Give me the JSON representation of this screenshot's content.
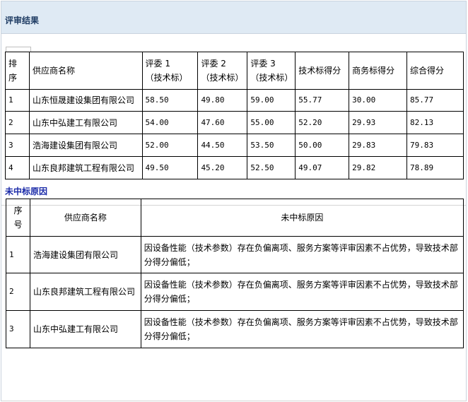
{
  "header": {
    "title": "评审结果"
  },
  "results": {
    "columns": {
      "rank": [
        "排",
        "序"
      ],
      "supplier": "供应商名称",
      "judge1": [
        "评委 1",
        "（技术标）"
      ],
      "judge2": [
        "评委 2",
        "（技术标）"
      ],
      "judge3": [
        "评委 3",
        "（技术标）"
      ],
      "tech_score": "技术标得分",
      "biz_score": "商务标得分",
      "total_score": "综合得分"
    },
    "rows": [
      {
        "rank": "1",
        "supplier": "山东恒晟建设集团有限公司",
        "j1": "58.50",
        "j2": "49.80",
        "j3": "59.00",
        "tech": "55.77",
        "biz": "30.00",
        "total": "85.77"
      },
      {
        "rank": "2",
        "supplier": "山东中弘建工有限公司",
        "j1": "54.00",
        "j2": "47.60",
        "j3": "55.00",
        "tech": "52.20",
        "biz": "29.93",
        "total": "82.13"
      },
      {
        "rank": "3",
        "supplier": "浩海建设集团有限公司",
        "j1": "52.00",
        "j2": "44.50",
        "j3": "53.50",
        "tech": "50.00",
        "biz": "29.83",
        "total": "79.83"
      },
      {
        "rank": "4",
        "supplier": "山东良邦建筑工程有限公司",
        "j1": "49.50",
        "j2": "45.20",
        "j3": "52.50",
        "tech": "49.07",
        "biz": "29.82",
        "total": "78.89"
      }
    ]
  },
  "reasons": {
    "title": "未中标原因",
    "columns": {
      "seq": [
        "序",
        "号"
      ],
      "supplier": "供应商名称",
      "reason": "未中标原因"
    },
    "rows": [
      {
        "seq": "1",
        "supplier": "浩海建设集团有限公司",
        "reason": "因设备性能（技术参数）存在负偏离项、服务方案等评审因素不占优势，导致技术部分得分偏低；"
      },
      {
        "seq": "2",
        "supplier": "山东良邦建筑工程有限公司",
        "reason": "因设备性能（技术参数）存在负偏离项、服务方案等评审因素不占优势，导致技术部分得分偏低；"
      },
      {
        "seq": "3",
        "supplier": "山东中弘建工有限公司",
        "reason": "因设备性能（技术参数）存在负偏离项、服务方案等评审因素不占优势，导致技术部分得分偏低；"
      }
    ]
  }
}
